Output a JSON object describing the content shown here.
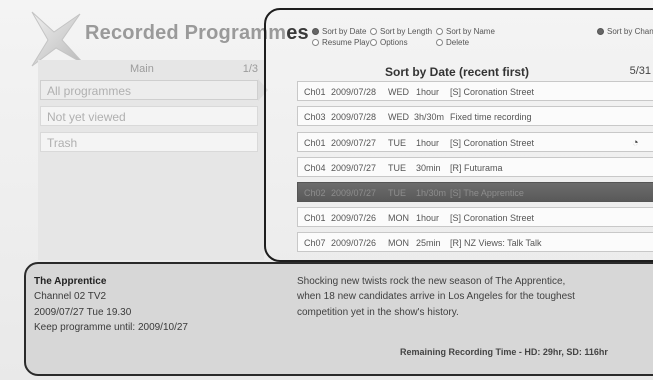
{
  "header": {
    "title_light": "Recorded Programm",
    "title_dark": "es"
  },
  "menu": {
    "title": "Main",
    "page": "1/3",
    "items": [
      {
        "label": "All programmes"
      },
      {
        "label": "Not yet viewed"
      },
      {
        "label": "Trash"
      }
    ]
  },
  "options": {
    "sort_by_date": "Sort by Date",
    "sort_by_length": "Sort by Length",
    "sort_by_name": "Sort by Name",
    "sort_by_channel": "Sort by Channe",
    "resume_play": "Resume Play",
    "options": "Options",
    "delete": "Delete"
  },
  "list": {
    "title": "Sort by Date (recent first)",
    "count": "5/31",
    "rows": [
      {
        "channel": "Ch01",
        "date": "2009/07/28",
        "day": "WED",
        "duration": "1hour",
        "title": "[S] Coronation Street",
        "icon": ""
      },
      {
        "channel": "Ch03",
        "date": "2009/07/28",
        "day": "WED",
        "duration": "3h/30m",
        "title": "Fixed time recording",
        "icon": ""
      },
      {
        "channel": "Ch01",
        "date": "2009/07/27",
        "day": "TUE",
        "duration": "1hour",
        "title": "[S] Coronation Street",
        "icon": "play-pause-icon"
      },
      {
        "channel": "Ch04",
        "date": "2009/07/27",
        "day": "TUE",
        "duration": "30min",
        "title": "[R] Futurama",
        "icon": ""
      },
      {
        "channel": "Ch02",
        "date": "2009/07/27",
        "day": "TUE",
        "duration": "1h/30m",
        "title": "[S] The Apprentice",
        "icon": ""
      },
      {
        "channel": "Ch01",
        "date": "2009/07/26",
        "day": "MON",
        "duration": "1hour",
        "title": "[S] Coronation Street",
        "icon": ""
      },
      {
        "channel": "Ch07",
        "date": "2009/07/26",
        "day": "MON",
        "duration": "25min",
        "title": "[R] NZ Views: Talk Talk",
        "icon": ""
      }
    ]
  },
  "info": {
    "title": "The Apprentice",
    "channel": "Channel 02 TV2",
    "datetime": "2009/07/27 Tue 19.30",
    "keep_until": "Keep programme until: 2009/10/27",
    "description_lines": [
      "Shocking new twists rock the new season of The Apprentice,",
      "when 18 new candidates arrive in Los Angeles for the toughest",
      "competition yet in the show's history."
    ],
    "remaining": "Remaining Recording Time - HD: 29hr, SD: 116hr"
  },
  "colors": {
    "selected_row": "#5f5f5f",
    "panel": "#d7d7d7"
  }
}
